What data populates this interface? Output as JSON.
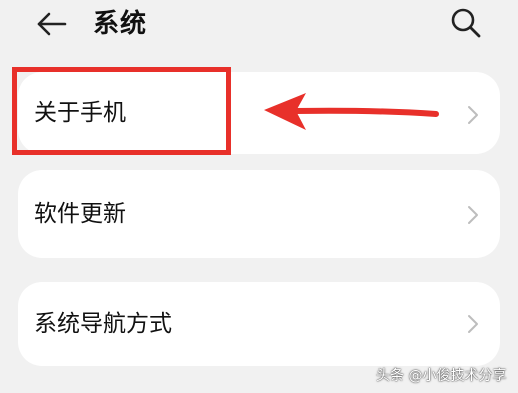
{
  "header": {
    "title": "系统",
    "back_icon": "back-arrow-icon",
    "search_icon": "search-icon"
  },
  "menu": {
    "items": [
      {
        "label": "关于手机",
        "icon": "chevron-right-icon"
      },
      {
        "label": "软件更新",
        "icon": "chevron-right-icon"
      },
      {
        "label": "系统导航方式",
        "icon": "chevron-right-icon"
      }
    ]
  },
  "annotation": {
    "color": "#e8302a",
    "shape": "red-box-with-arrow"
  },
  "watermark": {
    "text": "头条 @小俊技术分享"
  },
  "colors": {
    "background": "#f1f1f1",
    "card": "#ffffff",
    "chevron": "#bdbdbd"
  }
}
